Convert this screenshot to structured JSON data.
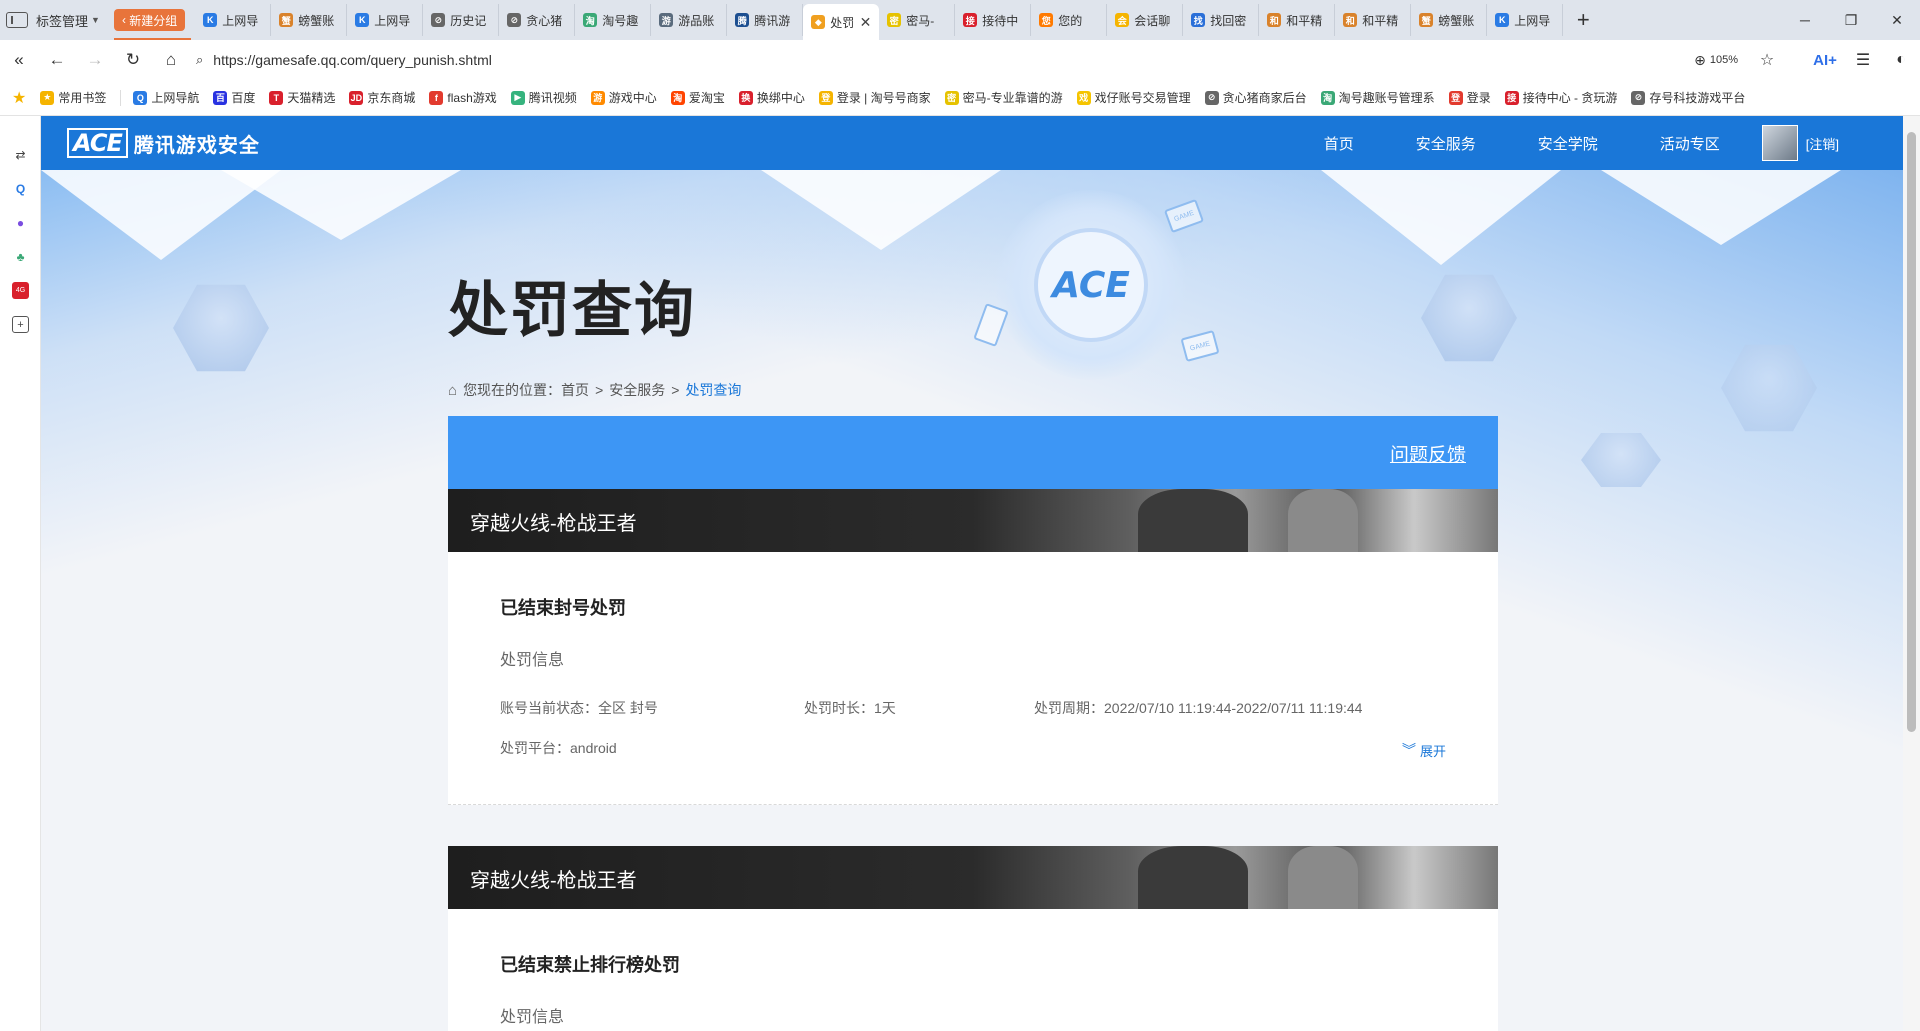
{
  "browser": {
    "tab_manager_label": "标签管理",
    "new_group_label": "新建分组",
    "tabs": [
      {
        "title": "上网导",
        "color": "#2a7be4",
        "glyph": "K"
      },
      {
        "title": "螃蟹账",
        "color": "#d9822b",
        "glyph": "蟹"
      },
      {
        "title": "上网导",
        "color": "#2a7be4",
        "glyph": "K"
      },
      {
        "title": "历史记",
        "color": "#666666",
        "glyph": "⊘"
      },
      {
        "title": "贪心猪",
        "color": "#666666",
        "glyph": "⊘"
      },
      {
        "title": "淘号趣",
        "color": "#3aa876",
        "glyph": "淘"
      },
      {
        "title": "游品账",
        "color": "#5a6b7d",
        "glyph": "游"
      },
      {
        "title": "腾讯游",
        "color": "#1d4f91",
        "glyph": "腾"
      },
      {
        "title": "处罚",
        "color": "#f0a020",
        "glyph": "◆",
        "active": true
      },
      {
        "title": "密马-",
        "color": "#e6c200",
        "glyph": "密"
      },
      {
        "title": "接待中",
        "color": "#d9202c",
        "glyph": "接"
      },
      {
        "title": "您的",
        "color": "#ff7a00",
        "glyph": "您"
      },
      {
        "title": "会话聊",
        "color": "#f5b400",
        "glyph": "会"
      },
      {
        "title": "找回密",
        "color": "#2a6fd8",
        "glyph": "找"
      },
      {
        "title": "和平精",
        "color": "#d9822b",
        "glyph": "和"
      },
      {
        "title": "和平精",
        "color": "#d9822b",
        "glyph": "和"
      },
      {
        "title": "螃蟹账",
        "color": "#d9822b",
        "glyph": "蟹"
      },
      {
        "title": "上网导",
        "color": "#2a7be4",
        "glyph": "K"
      }
    ],
    "url": "https://gamesafe.qq.com/query_punish.shtml",
    "zoom": "105%",
    "ai_label": "AI+",
    "bookmarks": [
      {
        "label": "常用书签",
        "color": "#f5b400",
        "glyph": "★"
      },
      {
        "label": "上网导航",
        "color": "#2a7be4",
        "glyph": "Q"
      },
      {
        "label": "百度",
        "color": "#2932e1",
        "glyph": "百"
      },
      {
        "label": "天猫精选",
        "color": "#d9202c",
        "glyph": "T"
      },
      {
        "label": "京东商城",
        "color": "#d9202c",
        "glyph": "JD"
      },
      {
        "label": "flash游戏",
        "color": "#e23a2e",
        "glyph": "f"
      },
      {
        "label": "腾讯视频",
        "color": "#36b37e",
        "glyph": "▶"
      },
      {
        "label": "游戏中心",
        "color": "#ff8a00",
        "glyph": "游"
      },
      {
        "label": "爱淘宝",
        "color": "#ff4400",
        "glyph": "淘"
      },
      {
        "label": "换绑中心",
        "color": "#d9202c",
        "glyph": "换"
      },
      {
        "label": "登录 | 淘号号商家",
        "color": "#f5b400",
        "glyph": "登"
      },
      {
        "label": "密马-专业靠谱的游",
        "color": "#e6c200",
        "glyph": "密"
      },
      {
        "label": "戏仔账号交易管理",
        "color": "#f5c400",
        "glyph": "戏"
      },
      {
        "label": "贪心猪商家后台",
        "color": "#666666",
        "glyph": "⊘"
      },
      {
        "label": "淘号趣账号管理系",
        "color": "#3aa876",
        "glyph": "淘"
      },
      {
        "label": "登录",
        "color": "#e23a2e",
        "glyph": "登"
      },
      {
        "label": "接待中心 - 贪玩游",
        "color": "#d9202c",
        "glyph": "接"
      },
      {
        "label": "存号科技游戏平台",
        "color": "#666666",
        "glyph": "⊘"
      }
    ]
  },
  "site": {
    "logo_text": "ACE",
    "logo_title": "腾讯游戏安全",
    "nav": [
      "首页",
      "安全服务",
      "安全学院",
      "活动专区"
    ],
    "logout": "[注销]",
    "page_title": "处罚查询",
    "breadcrumb": {
      "prefix": "您现在的位置：",
      "items": [
        "首页",
        "安全服务"
      ],
      "current": "处罚查询"
    },
    "feedback": "问题反馈",
    "records": [
      {
        "game": "穿越火线-枪战王者",
        "title": "已结束封号处罚",
        "section": "处罚信息",
        "status": "账号当前状态：全区 封号",
        "duration": "处罚时长：1天",
        "period": "处罚周期：2022/07/10 11:19:44-2022/07/11 11:19:44",
        "platform": "处罚平台：android",
        "expand": "展开"
      },
      {
        "game": "穿越火线-枪战王者",
        "title": "已结束禁止排行榜处罚",
        "section": "处罚信息"
      }
    ]
  },
  "colors": {
    "brand_blue": "#1a77d8",
    "card_head": "#3d96f5",
    "new_group": "#e8743b"
  }
}
